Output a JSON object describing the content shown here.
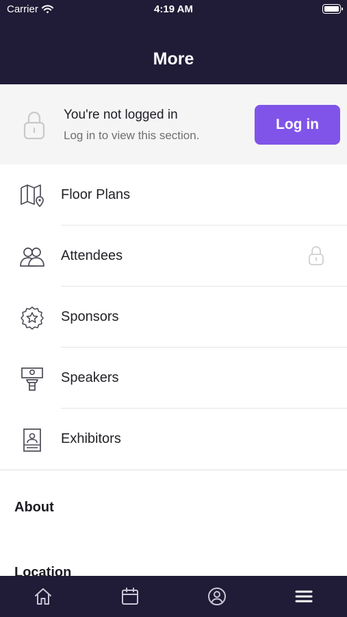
{
  "status_bar": {
    "carrier": "Carrier",
    "time": "4:19 AM"
  },
  "header": {
    "title": "More"
  },
  "login_banner": {
    "title": "You're not logged in",
    "subtitle": "Log in to view this section.",
    "button_label": "Log in",
    "accent_color": "#8054e9"
  },
  "menu": {
    "items": [
      {
        "label": "Floor Plans",
        "icon": "map-pin-icon",
        "locked": false
      },
      {
        "label": "Attendees",
        "icon": "people-icon",
        "locked": true
      },
      {
        "label": "Sponsors",
        "icon": "star-badge-icon",
        "locked": false
      },
      {
        "label": "Speakers",
        "icon": "podium-speaker-icon",
        "locked": false
      },
      {
        "label": "Exhibitors",
        "icon": "id-card-icon",
        "locked": false
      }
    ]
  },
  "sections": {
    "about": "About",
    "location": "Location"
  },
  "tab_bar": {
    "tabs": [
      {
        "icon": "home-icon",
        "active": false
      },
      {
        "icon": "calendar-icon",
        "active": false
      },
      {
        "icon": "profile-icon",
        "active": false
      },
      {
        "icon": "menu-icon",
        "active": true
      }
    ]
  },
  "colors": {
    "header_bg": "#201c37",
    "banner_bg": "#f5f5f5"
  }
}
